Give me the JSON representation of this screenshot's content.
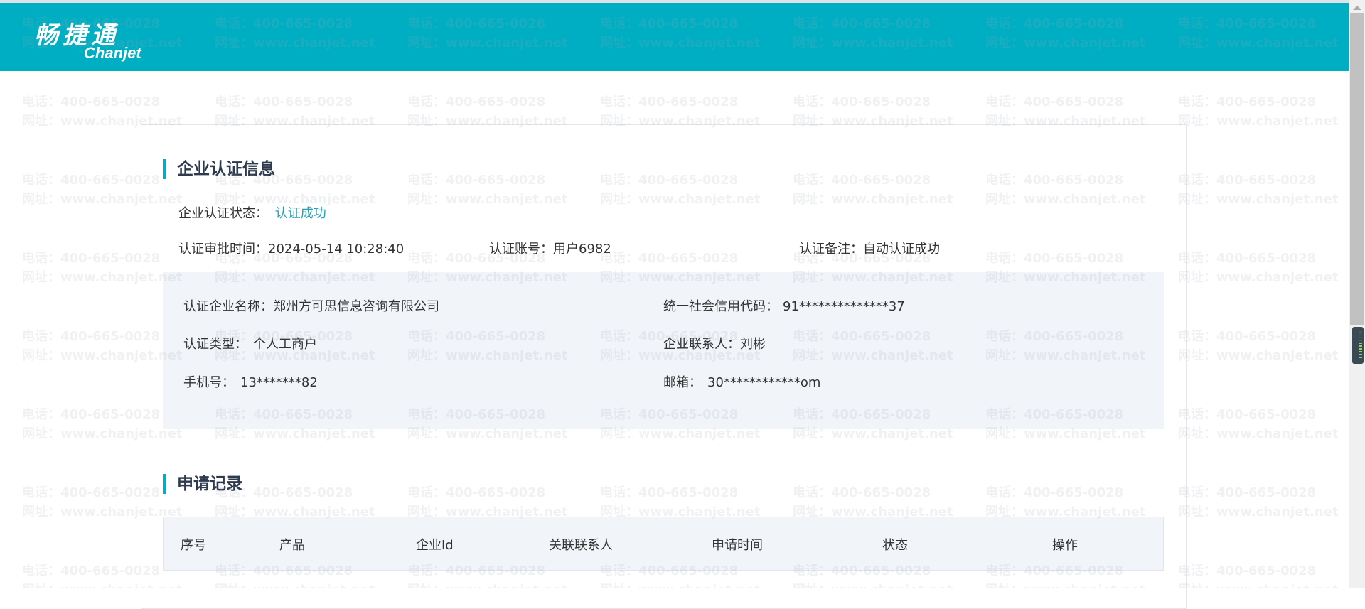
{
  "header": {
    "logo_cn": "畅捷通",
    "logo_en": "Chanjet"
  },
  "watermark": {
    "phone": "电话：400-665-0028",
    "site": "网址：www.chanjet.net"
  },
  "certification": {
    "title": "企业认证信息",
    "status_label": "企业认证状态：",
    "status_value": "认证成功",
    "approval_time_label": "认证审批时间：",
    "approval_time_value": "2024-05-14 10:28:40",
    "account_label": "认证账号：",
    "account_value": "用户6982",
    "remark_label": "认证备注：",
    "remark_value": "自动认证成功",
    "company_name_label": "认证企业名称：",
    "company_name_value": "郑州方可思信息咨询有限公司",
    "credit_code_label": "统一社会信用代码：",
    "credit_code_value": "91**************37",
    "type_label": "认证类型：",
    "type_value": "个人工商户",
    "contact_label": "企业联系人：",
    "contact_value": "刘彬",
    "phone_label": "手机号：",
    "phone_value": "13*******82",
    "email_label": "邮箱：",
    "email_value": "30************om"
  },
  "records": {
    "title": "申请记录",
    "columns": [
      "序号",
      "产品",
      "企业Id",
      "关联联系人",
      "申请时间",
      "状态",
      "操作"
    ]
  }
}
